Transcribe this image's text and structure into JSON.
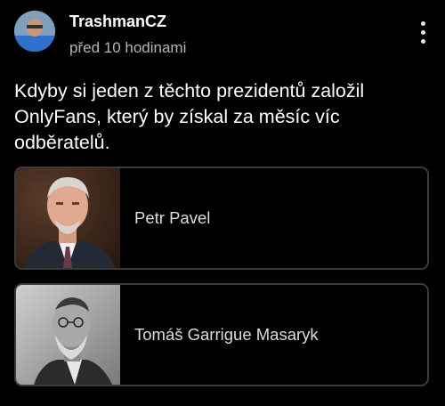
{
  "post": {
    "author": "TrashmanCZ",
    "timestamp": "před 10 hodinami",
    "question": "Kdyby si jeden z těchto prezidentů založil OnlyFans, který by získal za měsíc víc odběratelů."
  },
  "poll": {
    "options": [
      {
        "label": "Petr Pavel"
      },
      {
        "label": "Tomáš Garrigue Masaryk"
      }
    ]
  },
  "icons": {
    "menu": "more-vertical-icon"
  },
  "colors": {
    "background": "#000000",
    "text": "#ffffff",
    "muted": "#b5b5b5",
    "option_border": "#3a3a3a"
  }
}
